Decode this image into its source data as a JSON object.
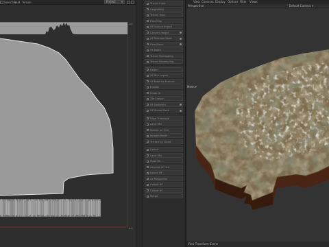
{
  "left_menubar": {
    "items": [
      "Selection",
      "Field",
      "Terrain"
    ],
    "project_label": "Project",
    "project_arrow": "▾"
  },
  "histogram": {
    "top_right_label": "1.0",
    "bottom_right_label": "0.0",
    "curve_color": "#d8d8d8",
    "fill_color": "#9a9a9a",
    "baseline_color": "#9c2d2d"
  },
  "node_list": {
    "items": [
      {
        "label": "Terrain Input",
        "dot": false
      },
      {
        "label": "Heightfield",
        "dot": false
      },
      {
        "label": "Terrain Tiles",
        "dot": false
      },
      {
        "label": "Flow Map",
        "dot": false
      },
      {
        "label": "HF Texture Import",
        "dot": false
      },
      {
        "label": "Convert Height",
        "dot": true
      },
      {
        "label": "HF Reshape Mask",
        "dot": true
      },
      {
        "label": "Flow Blend",
        "dot": true
      },
      {
        "label": "HF Noise",
        "dot": false
      },
      {
        "label": "Terrain Remapping",
        "dot": false
      },
      {
        "label": "Terrain Resampling",
        "dot": false
      },
      {
        "label": "Distort",
        "dot": false
      },
      {
        "label": "HF Blur Layers",
        "dot": false
      },
      {
        "label": "HF Mask by Feature",
        "dot": false
      },
      {
        "label": "Erosion",
        "dot": false
      },
      {
        "label": "Erode Hi",
        "dot": false
      },
      {
        "label": "Tile Erosion",
        "dot": false
      },
      {
        "label": "HF Sediment",
        "dot": true
      },
      {
        "label": "HF Slump Mask",
        "dot": true
      },
      {
        "label": "Edge Threshold",
        "dot": false
      },
      {
        "label": "Layer Mix",
        "dot": false
      },
      {
        "label": "Scatter on Grid",
        "dot": false
      },
      {
        "label": "Smooth Relief",
        "dot": false
      },
      {
        "label": "Terrace by Count",
        "dot": false
      },
      {
        "label": "Output",
        "dot": false
      },
      {
        "label": "Layer Mix",
        "dot": false
      },
      {
        "label": "Mask Fill",
        "dot": false
      },
      {
        "label": "Layered HF Out",
        "dot": false
      },
      {
        "label": "Export HF",
        "dot": false
      },
      {
        "label": "HF Polygonize",
        "dot": false
      },
      {
        "label": "Output HF",
        "dot": false
      },
      {
        "label": "Output HF",
        "dot": false
      },
      {
        "label": "Merge",
        "dot": false
      }
    ]
  },
  "viewport": {
    "menu": [
      "View",
      "Cameras",
      "Display",
      "Options",
      "Filter",
      "Views"
    ],
    "perspective_label": "Perspective",
    "camera_label": "Default Camera ▾",
    "side_label": "Mesh ▾",
    "status_text": "View Transform Scene",
    "bg_color": "#333333",
    "terrain_side_color": "#4a2414"
  }
}
